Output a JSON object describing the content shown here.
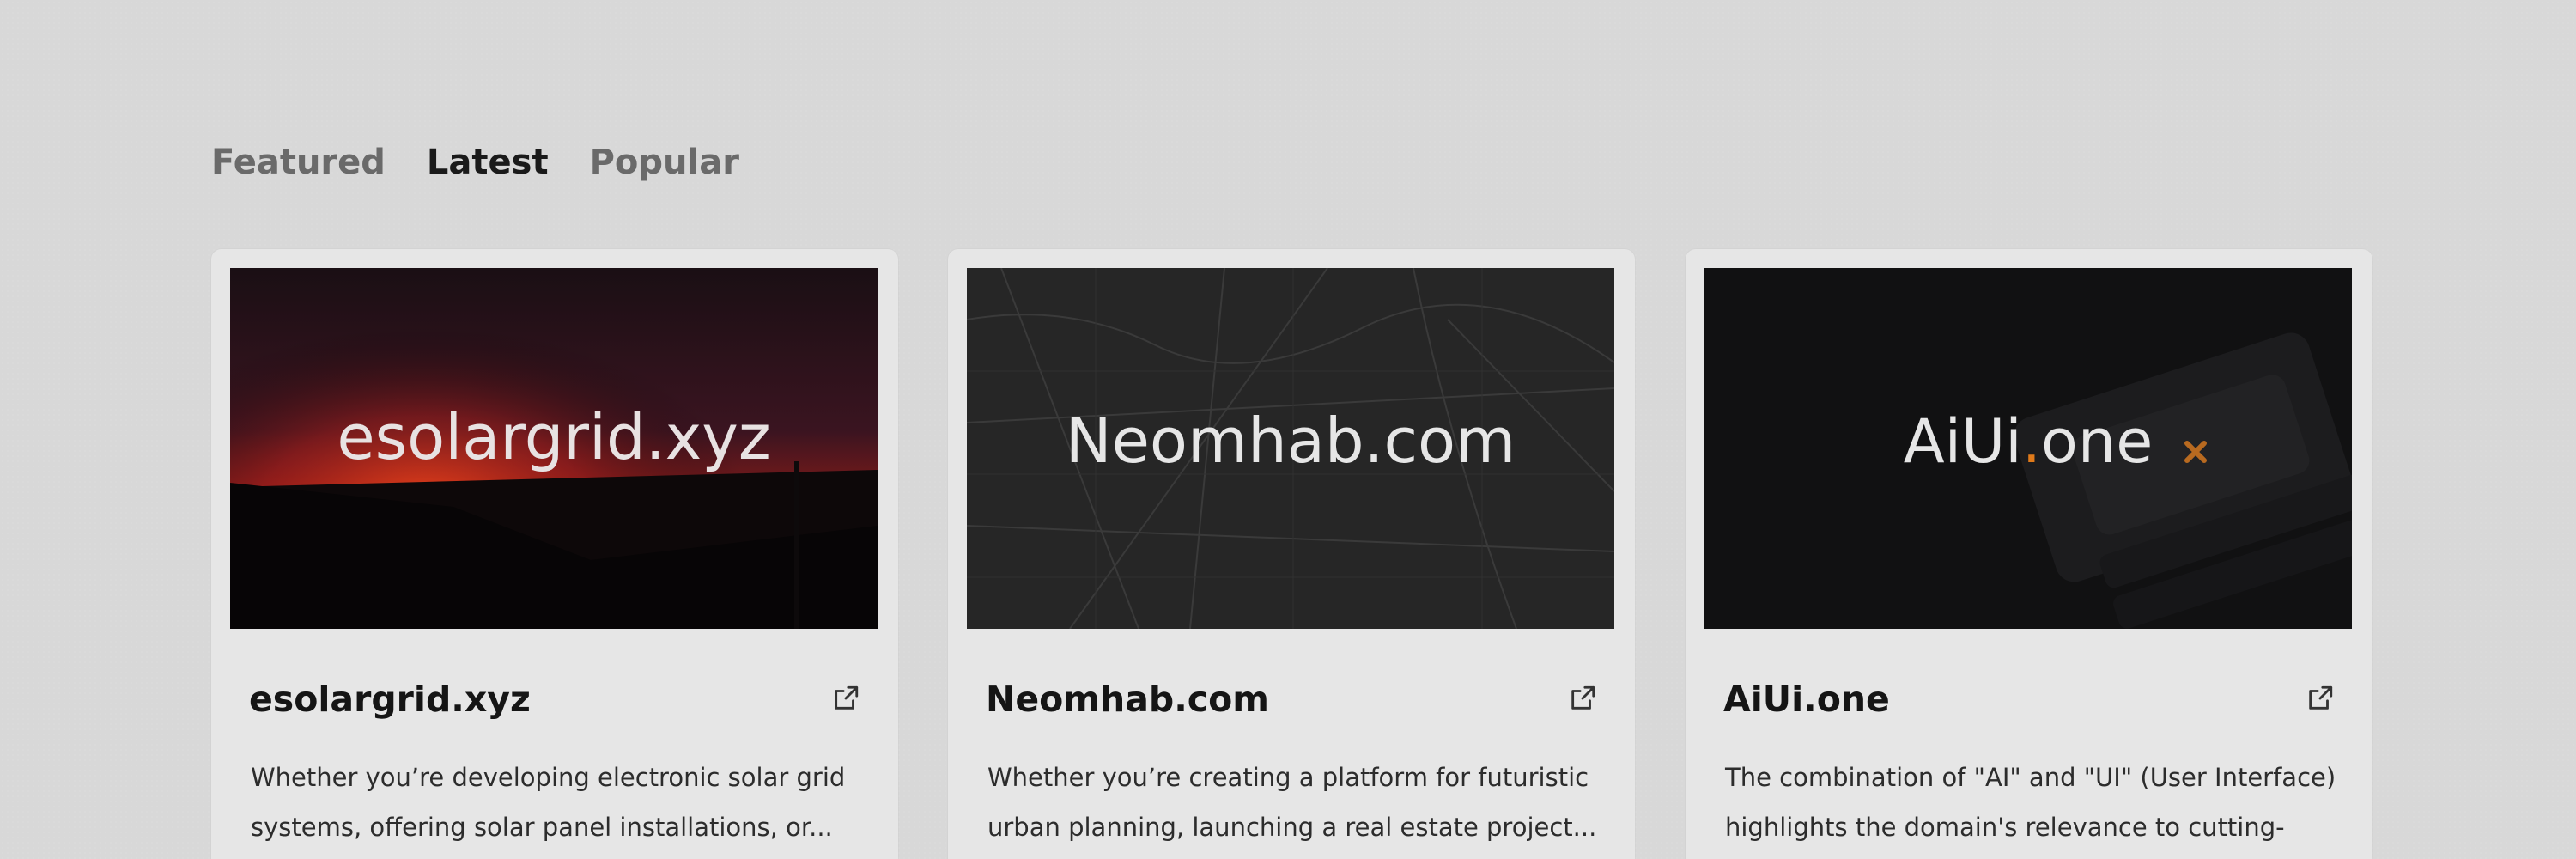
{
  "tabs": [
    {
      "label": "Featured",
      "active": false
    },
    {
      "label": "Latest",
      "active": true
    },
    {
      "label": "Popular",
      "active": false
    }
  ],
  "cards": [
    {
      "image_text": "esolargrid.xyz",
      "title": "esolargrid.xyz",
      "desc_line1": "Whether you’re developing electronic solar grid",
      "desc_line2": "systems, offering solar panel installations, or..."
    },
    {
      "image_text": "Neomhab.com",
      "title": "Neomhab.com",
      "desc_line1": "Whether you’re creating a platform for futuristic",
      "desc_line2": "urban planning, launching a real estate project..."
    },
    {
      "image_text_main": "AiUi",
      "image_text_dot": ".",
      "image_text_tail": "one",
      "title": "AiUi.one",
      "desc_line1": "The combination of \"AI\" and \"UI\" (User Interface)",
      "desc_line2": "highlights the domain's relevance to cutting-ed..."
    }
  ],
  "icons": {
    "external": "external-link-icon"
  },
  "colors": {
    "background": "#d8d8d8",
    "card": "#e6e6e6",
    "accent_orange": "#e07a1a",
    "solar_red": "#c8301c"
  }
}
